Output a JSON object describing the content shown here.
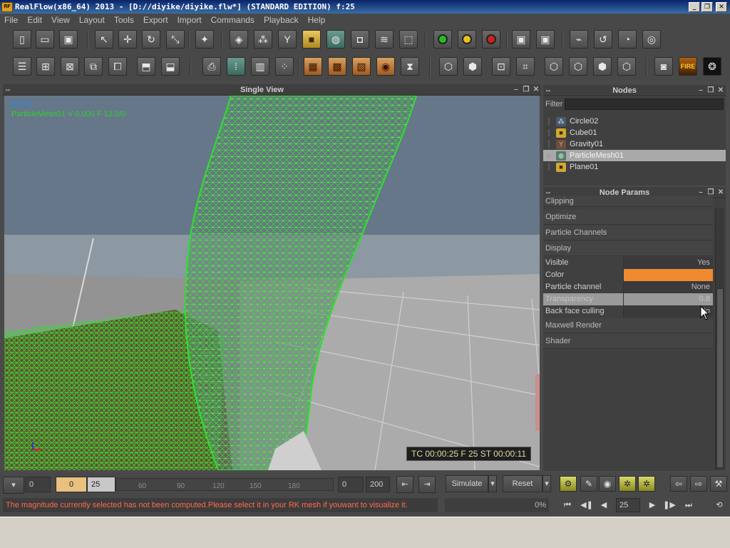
{
  "window": {
    "title": "RealFlow(x86_64) 2013 - [D://diyike/diyike.flw*] (STANDARD EDITION) f:25",
    "app_icon_text": "RF",
    "controls": {
      "minimize": "_",
      "maximize": "❐",
      "close": "✕"
    }
  },
  "menu": [
    "File",
    "Edit",
    "View",
    "Layout",
    "Tools",
    "Export",
    "Import",
    "Commands",
    "Playback",
    "Help"
  ],
  "toolbar_icons_row1": [
    "new-file-icon",
    "open-folder-icon",
    "save-icon",
    "select-icon",
    "move-icon",
    "rotate-icon",
    "scale-icon",
    "axis-icon",
    "object-icon",
    "emitters-icon",
    "daemons-icon",
    "cube-icon",
    "mesh-icon",
    "camera-icon",
    "waves-icon",
    "grid-cube-icon",
    "green-record-icon",
    "yellow-record-icon",
    "red-record-icon",
    "save-green-icon",
    "save-red-icon",
    "graph-play-icon",
    "loop-icon",
    "timer-icon",
    "globe-icon"
  ],
  "toolbar_icons_row2": [
    "list-icon",
    "add-node-icon",
    "remove-node-icon",
    "link-icon",
    "unlink-icon",
    "box-icon",
    "box-split-icon",
    "export-icon",
    "particles-icon",
    "column-icon",
    "spray-icon",
    "crate-icon",
    "crate-red-icon",
    "crate-cross-icon",
    "crate-circle-icon",
    "hourglass-icon",
    "wire-cube-icon",
    "dotted-cube-icon",
    "target-icon",
    "corners-icon",
    "cube-a-icon",
    "cube-b-icon",
    "cube-c-icon",
    "cube-d-icon",
    "render-icon",
    "fire-icon",
    "smoke-icon"
  ],
  "fire_label": "FIRE",
  "single_view": {
    "title": "Single View",
    "camera": "persp",
    "object_info": "ParticleMesh01 V 0.000 F 12.0/0",
    "readout": "TC 00:00:25   F 25   ST 00:00:11"
  },
  "nodes": {
    "title": "Nodes",
    "filter_label": "Filter",
    "filter_value": "",
    "items": [
      {
        "name": "Circle02",
        "icon": "emitter-icon",
        "selected": false
      },
      {
        "name": "Cube01",
        "icon": "cube-icon",
        "selected": false
      },
      {
        "name": "Gravity01",
        "icon": "gravity-icon",
        "selected": false
      },
      {
        "name": "ParticleMesh01",
        "icon": "mesh-icon",
        "selected": true
      },
      {
        "name": "Plane01",
        "icon": "plane-icon",
        "selected": false
      }
    ]
  },
  "node_params": {
    "title": "Node Params",
    "sections": [
      "Clipping",
      "Optimize",
      "Particle Channels",
      "Display",
      "Maxwell Render",
      "Shader"
    ],
    "display_rows": [
      {
        "label": "Visible",
        "value": "Yes"
      },
      {
        "label": "Color",
        "value": "",
        "color": "#f08a30"
      },
      {
        "label": "Particle channel",
        "value": "None"
      },
      {
        "label": "Transparency",
        "value": "0.8"
      },
      {
        "label": "Back face culling",
        "value": "No"
      }
    ]
  },
  "timeline": {
    "start": "0",
    "current_marker": "0",
    "current": "25",
    "ticks": [
      "60",
      "90",
      "120",
      "150",
      "180"
    ],
    "range_start": "0",
    "range_end": "200",
    "simulate": "Simulate",
    "reset": "Reset",
    "frame": "25",
    "progress": "0%"
  },
  "status_message": "The magnitude currently selected has not been computed.Please select it in your RK mesh if youwant to visualize it.",
  "playback_controls": [
    "first-frame-icon",
    "prev-key-icon",
    "prev-frame-icon",
    "next-frame-icon",
    "next-key-icon",
    "last-frame-icon",
    "loop-icon"
  ],
  "playback_glyphs": [
    "⏮",
    "◀❚",
    "◀",
    "▶",
    "❚▶",
    "⏭",
    "⟲"
  ],
  "colors": {
    "mesh": "#2fe02f",
    "param_color": "#f08a30",
    "status_error": "#ff6a4c"
  }
}
